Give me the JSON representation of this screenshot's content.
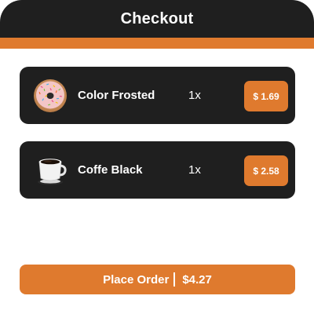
{
  "header": {
    "title": "Checkout"
  },
  "items": [
    {
      "name": "Color Frosted",
      "quantity": "1x",
      "price": "$ 1.69",
      "icon": "donut-icon"
    },
    {
      "name": "Coffe Black",
      "quantity": "1x",
      "price": "$ 2.58",
      "icon": "coffee-cup-icon"
    }
  ],
  "footer": {
    "place_order_label": "Place Order",
    "total": "$4.27"
  },
  "colors": {
    "accent": "#df7a2e",
    "dark": "#1f1f1f",
    "text": "#ffffff"
  }
}
